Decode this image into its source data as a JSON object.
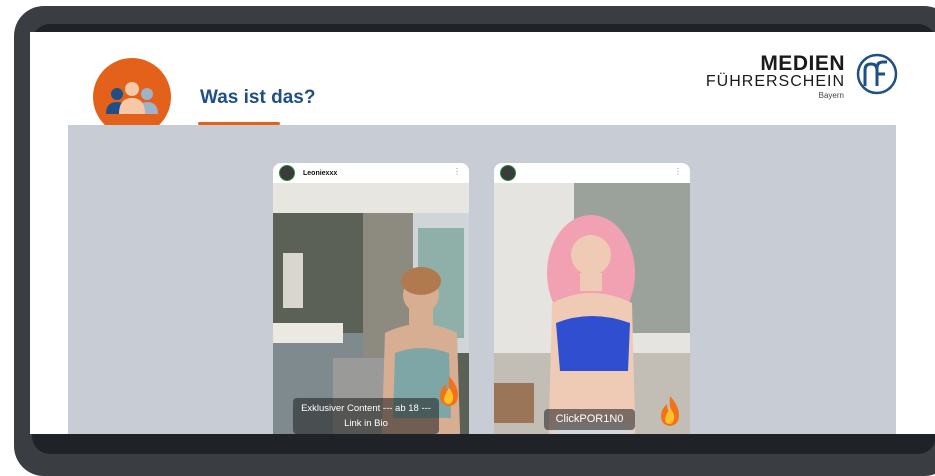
{
  "header": {
    "title": "Was ist das?",
    "logo": {
      "line1": "MEDIEN",
      "line2": "FÜHRERSCHEIN",
      "line3": "Bayern"
    }
  },
  "posts": [
    {
      "username": "Leoniexxx",
      "caption": "Exklusiver Content --- ab 18 --- Link in Bio"
    },
    {
      "username": "",
      "caption": "ClickPOR1N0"
    }
  ],
  "colors": {
    "accent": "#e4611b",
    "title": "#1f4f86",
    "content_bg": "#c8ccd4"
  },
  "icons": [
    "people-group-icon",
    "medienfuehrerschein-logo-icon",
    "flame-icon",
    "more-dots-icon"
  ]
}
